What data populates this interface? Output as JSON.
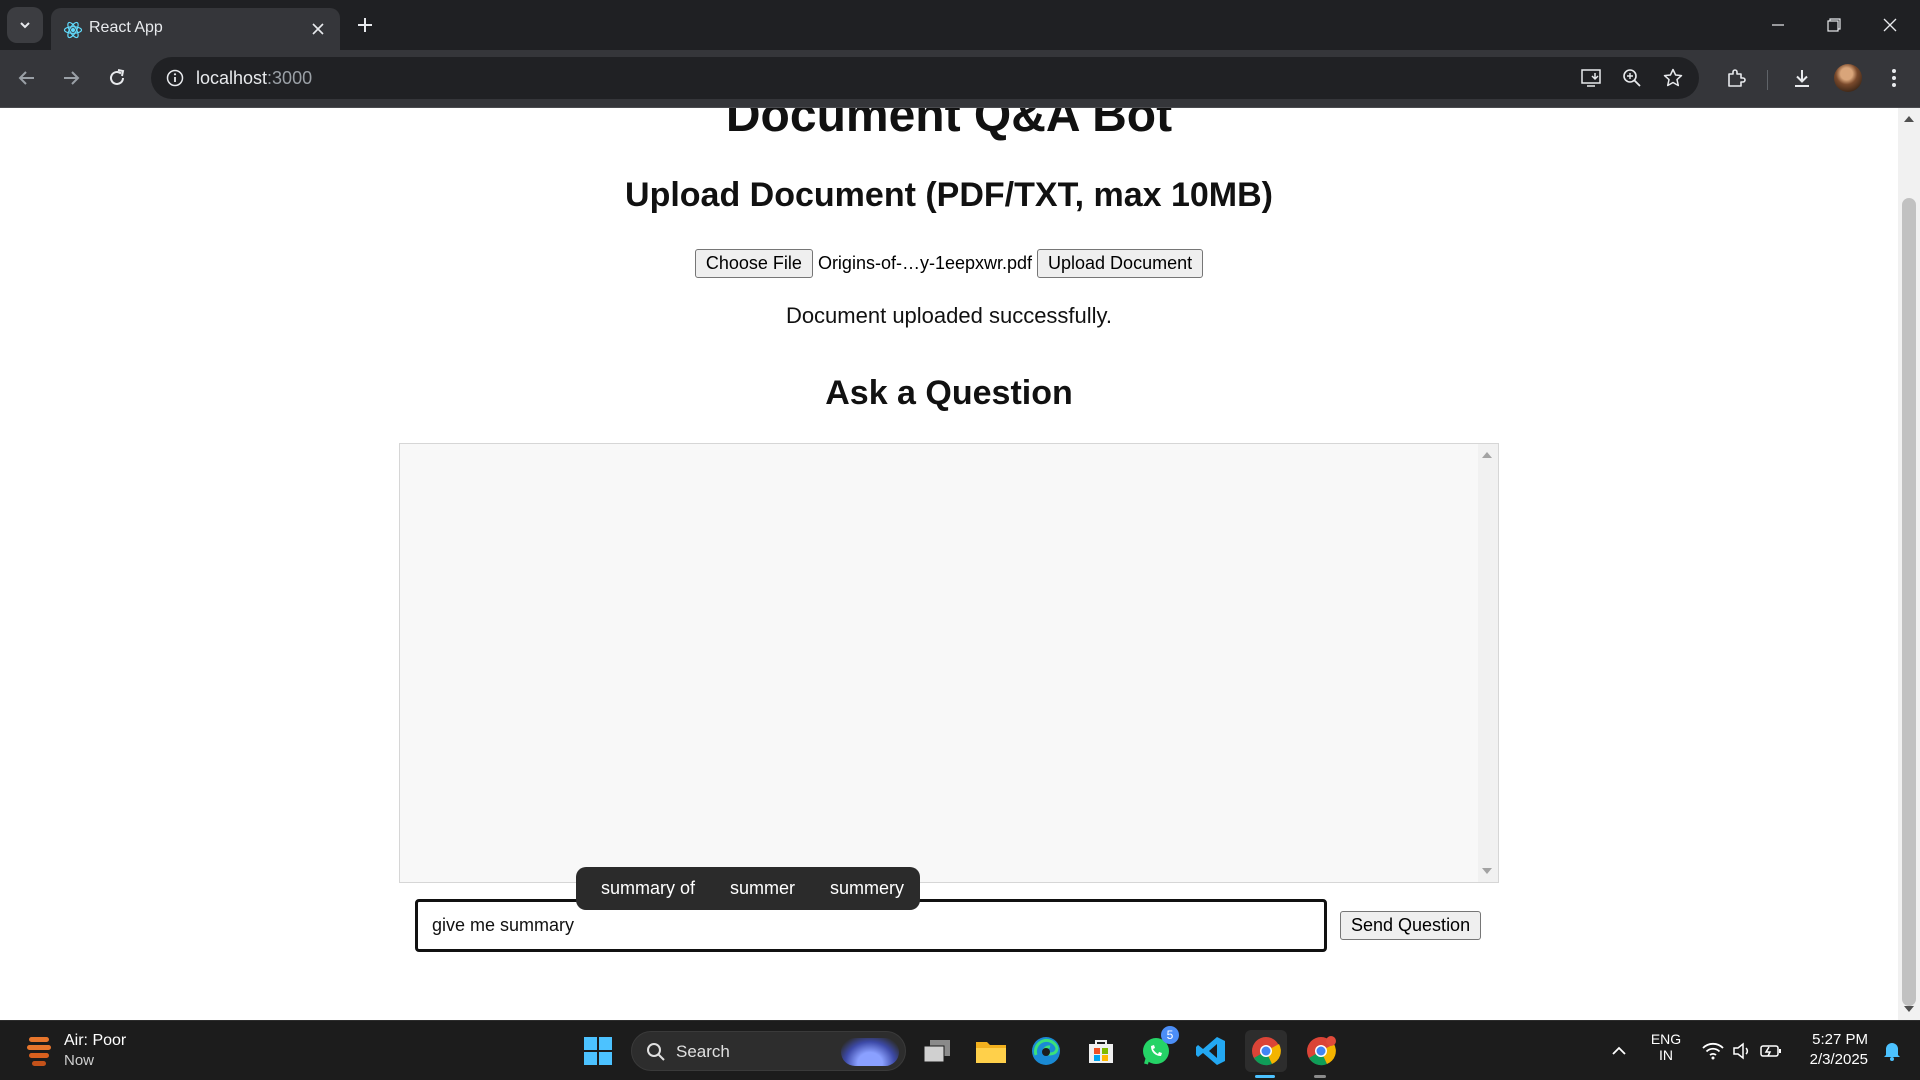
{
  "browser": {
    "tab_title": "React App",
    "url_host": "localhost",
    "url_port": ":3000"
  },
  "page": {
    "heading": "Document Q&A Bot",
    "upload_heading": "Upload Document (PDF/TXT, max 10MB)",
    "choose_file_label": "Choose File",
    "file_name": "Origins-of-…y-1eepxwr.pdf",
    "upload_button_label": "Upload Document",
    "upload_status": "Document uploaded successfully.",
    "ask_heading": "Ask a Question",
    "question_value": "give me summary",
    "send_button_label": "Send Question",
    "suggestions": [
      "summary of",
      "summer",
      "summery"
    ]
  },
  "taskbar": {
    "weather_title": "Air: Poor",
    "weather_time": "Now",
    "search_placeholder": "Search",
    "whatsapp_badge": "5",
    "lang_line1": "ENG",
    "lang_line2": "IN",
    "time": "5:27 PM",
    "date": "2/3/2025"
  },
  "colors": {
    "chrome_dark": "#1f2023",
    "toolbar": "#35363a",
    "taskbar": "#1c1c1c",
    "suggestion_bg": "#2b2b2b"
  }
}
